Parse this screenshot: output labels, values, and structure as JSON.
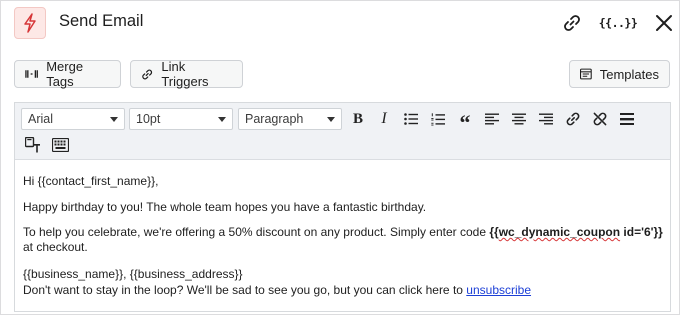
{
  "header": {
    "title": "Send Email",
    "link_icon": "link-icon",
    "merge_icon_text": "{{..}}",
    "close_icon": "close-icon",
    "badge_icon": "lightning-bolt-icon",
    "badge_color": "#d63638"
  },
  "actions": {
    "merge_tags_label": "Merge Tags",
    "link_triggers_label": "Link Triggers",
    "templates_label": "Templates"
  },
  "toolbar": {
    "font_family": "Arial",
    "font_size": "10pt",
    "block_format": "Paragraph",
    "buttons": [
      "bold-icon",
      "italic-icon",
      "bullet-list-icon",
      "numbered-list-icon",
      "blockquote-icon",
      "align-left-icon",
      "align-center-icon",
      "align-right-icon",
      "insert-link-icon",
      "unlink-icon",
      "horizontal-rule-icon",
      "paste-as-text-icon",
      "keyboard-shortcuts-icon"
    ]
  },
  "body": {
    "greeting": "Hi {{contact_first_name}},",
    "line1": "Happy birthday to you! The whole team hopes you have a fantastic birthday.",
    "line2_before": "To help you celebrate, we're offering a 50% discount on any product. Simply enter code ",
    "line2_code_prefix": "{{",
    "line2_code_word": "wc_dynamic_coupon",
    "line2_code_suffix": " id='6'}}",
    "line2_after": " at checkout.",
    "signature": "{{business_name}}, {{business_address}}",
    "footer_before": "Don't want to stay in the loop? We'll be sad to see you go, but you can click here to ",
    "footer_link": "unsubscribe"
  }
}
